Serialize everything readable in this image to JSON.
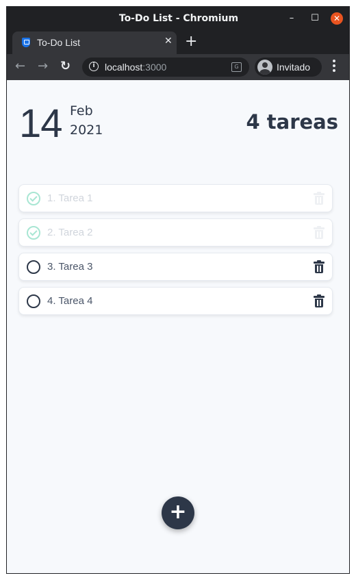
{
  "window": {
    "title": "To-Do List - Chromium"
  },
  "tabs": [
    {
      "title": "To-Do List"
    }
  ],
  "toolbar": {
    "url_host": "localhost",
    "url_port": ":3000",
    "profile_name": "Invitado"
  },
  "header": {
    "day": "14",
    "month": "Feb",
    "year": "2021",
    "count_label": "4 tareas"
  },
  "tasks": [
    {
      "label": "1. Tarea 1",
      "done": true
    },
    {
      "label": "2. Tarea 2",
      "done": true
    },
    {
      "label": "3. Tarea 3",
      "done": false
    },
    {
      "label": "4. Tarea 4",
      "done": false
    }
  ],
  "fab": {
    "symbol": "+"
  },
  "colors": {
    "primary": "#2d3748",
    "done_check": "#a8e6d3",
    "background": "#f7f9fc"
  }
}
